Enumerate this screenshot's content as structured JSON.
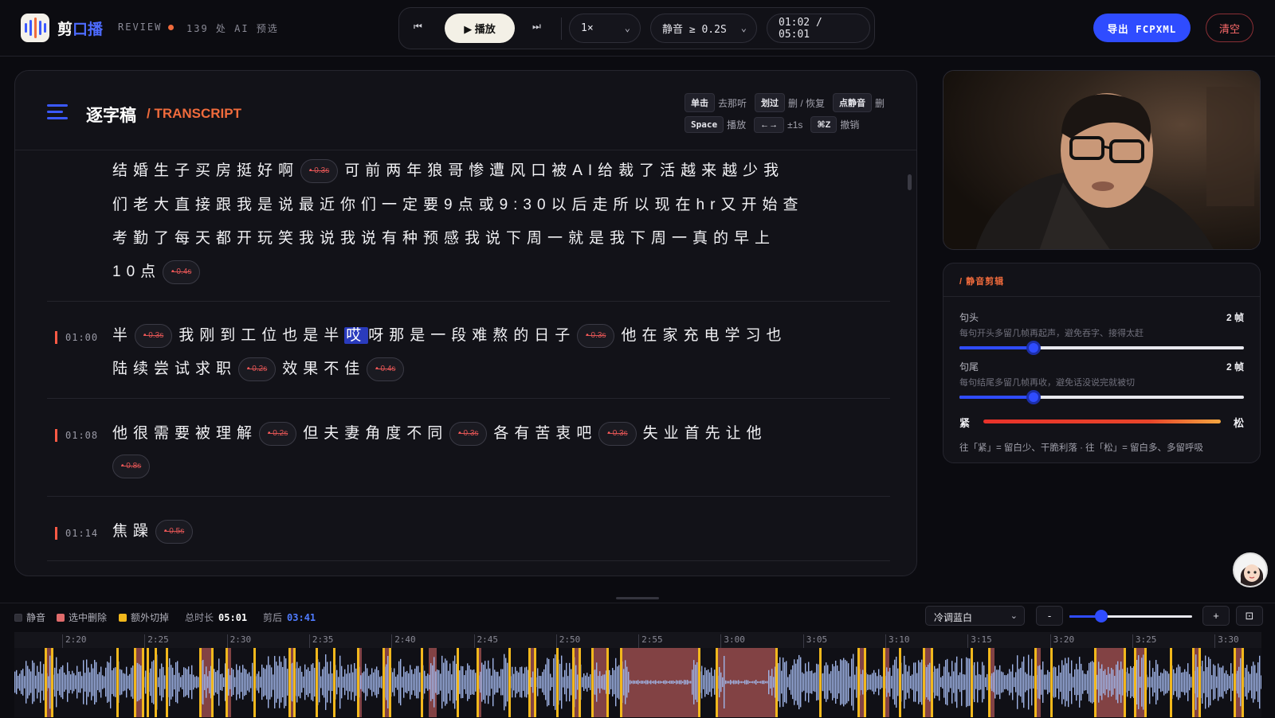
{
  "header": {
    "app_name_a": "剪",
    "app_name_b": "口播",
    "review_label": "REVIEW",
    "review_count": "139 处 AI 预选",
    "prev_glyph": "⏮",
    "play_label": "▶ 播放",
    "next_glyph": "⏭",
    "speed_value": "1×",
    "silence_filter": "静音 ≥ 0.2S",
    "time_display": "01:02 / 05:01",
    "export_label": "导出 FCPXML",
    "clear_label": "清空"
  },
  "transcript": {
    "title": "逐字稿",
    "subtitle": "/ TRANSCRIPT",
    "hints": {
      "click_key": "单击",
      "click_desc": "去那听",
      "strike_key": "划过",
      "strike_desc": "删 / 恢复",
      "silence_key": "点静音",
      "silence_desc": "删",
      "space_key": "Space",
      "space_desc": "播放",
      "arrow_key": "←→",
      "arrow_desc": "±1s",
      "undo_key": "⌘Z",
      "undo_desc": "撤销"
    },
    "p1": {
      "l1a": "结婚生子买房挺好啊",
      "g1": "0.3s",
      "l1b": "可前两年狼哥惨遭风口被AI给裁了活越来越少我",
      "l2": "们老大直接跟我是说最近你们一定要9点或9:30以后走所以现在hr又开始查",
      "l3": "考勤了每天都开玩笑我说我说有种预感我说下周一就是我下周一真的早上",
      "l4": "10点",
      "g2": "0.4s"
    },
    "p2": {
      "time": "01:00",
      "l1a": "半",
      "g1": "0.3s",
      "l1b": "我刚到工位也是半",
      "l1hl": "哎",
      "l1c": "呀那是一段难熬的日子",
      "g2": "0.3s",
      "l1d": "他在家充电学习也",
      "l2a": "陆续尝试求职",
      "g3": "0.2s",
      "l2b": "效果不佳",
      "g4": "0.4s"
    },
    "p3": {
      "time": "01:08",
      "l1a": "他很需要被理解",
      "g1": "0.2s",
      "l1b": "但夫妻角度不同",
      "g2": "0.3s",
      "l1c": "各有苦衷吧",
      "g3": "0.3s",
      "l1d": "失业首先让他",
      "g4": "0.8s"
    },
    "p4": {
      "time": "01:14",
      "l1a": "焦躁",
      "g1": "0.5s"
    }
  },
  "silence_edit": {
    "title": "/ 静音剪辑",
    "head_label": "句头",
    "head_value": "2 帧",
    "head_desc": "每句开头多留几帧再起声，避免吞字、接得太赶",
    "head_level": 0.26,
    "tail_label": "句尾",
    "tail_value": "2 帧",
    "tail_desc": "每句结尾多留几帧再收，避免话没说完就被切",
    "tail_level": 0.26,
    "tight_label": "紧",
    "loose_label": "松",
    "footer": "往「紧」= 留白少、干脆利落  ·  往「松」= 留白多、多留呼吸"
  },
  "timeline": {
    "legend_silence": "静音",
    "legend_selected": "选中删除",
    "legend_extra": "额外切掉",
    "total_label": "总时长",
    "total_value": "05:01",
    "after_label": "剪后",
    "after_value": "03:41",
    "theme": "冷调蓝白",
    "zoom_out": "-",
    "zoom_in": "+",
    "fit": "⊡",
    "zoom_level": 0.26,
    "ticks": [
      "2:20",
      "2:25",
      "2:30",
      "2:35",
      "2:40",
      "2:45",
      "2:50",
      "2:55",
      "3:00",
      "3:05",
      "3:10",
      "3:15",
      "3:20",
      "3:25",
      "3:30"
    ],
    "colors": {
      "silence": "#3a3a44",
      "selected": "#e06b6b",
      "extra": "#f2b81c",
      "wave": "#9fb3e6"
    }
  }
}
